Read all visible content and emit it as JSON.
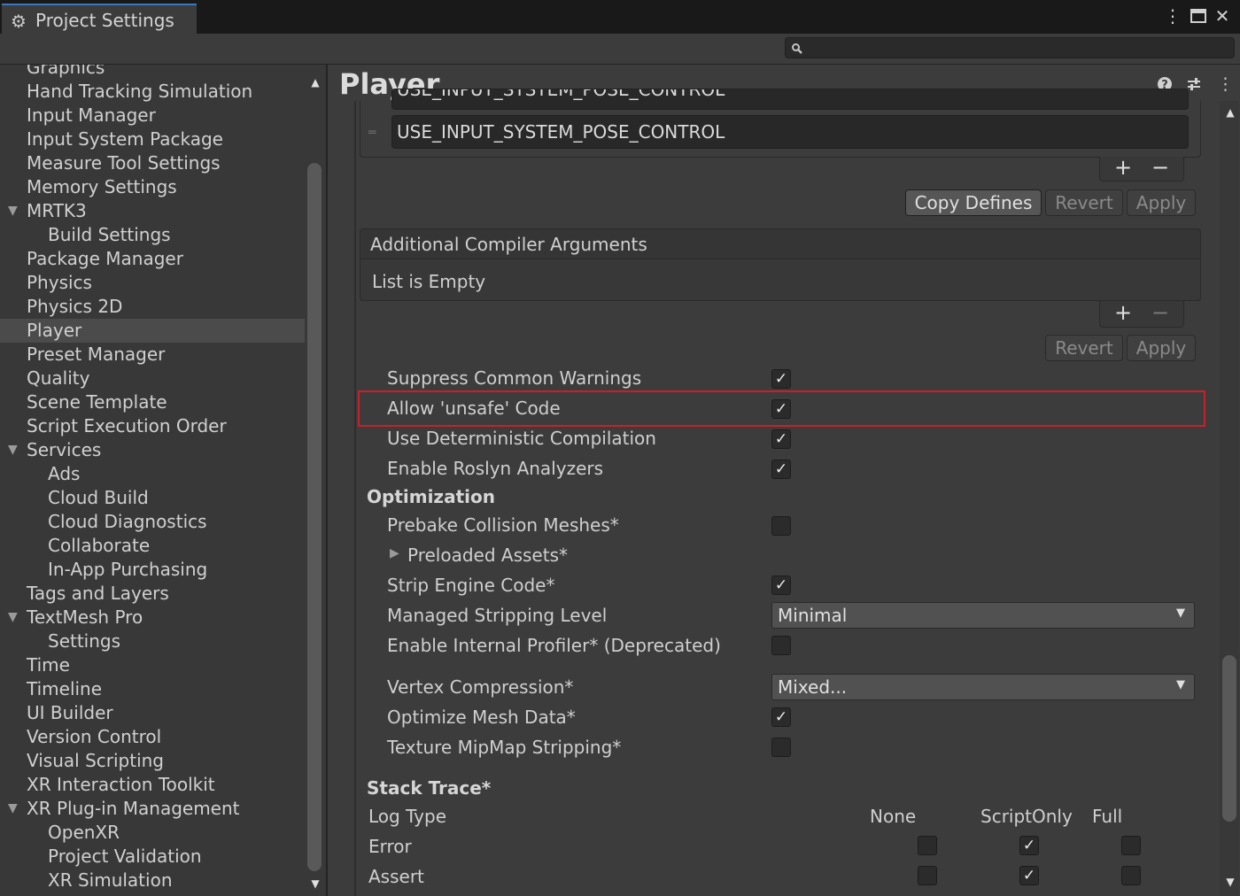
{
  "window": {
    "tab_title": "Project Settings",
    "tab_icon": "gear-icon"
  },
  "search": {
    "value": "",
    "placeholder": ""
  },
  "sidebar": {
    "items": [
      {
        "label": "Graphics",
        "indent": 0,
        "expandable": false,
        "selected": false
      },
      {
        "label": "Hand Tracking Simulation",
        "indent": 0,
        "expandable": false,
        "selected": false
      },
      {
        "label": "Input Manager",
        "indent": 0,
        "expandable": false,
        "selected": false
      },
      {
        "label": "Input System Package",
        "indent": 0,
        "expandable": false,
        "selected": false
      },
      {
        "label": "Measure Tool Settings",
        "indent": 0,
        "expandable": false,
        "selected": false
      },
      {
        "label": "Memory Settings",
        "indent": 0,
        "expandable": false,
        "selected": false
      },
      {
        "label": "MRTK3",
        "indent": 0,
        "expandable": true,
        "selected": false
      },
      {
        "label": "Build Settings",
        "indent": 1,
        "expandable": false,
        "selected": false
      },
      {
        "label": "Package Manager",
        "indent": 0,
        "expandable": false,
        "selected": false
      },
      {
        "label": "Physics",
        "indent": 0,
        "expandable": false,
        "selected": false
      },
      {
        "label": "Physics 2D",
        "indent": 0,
        "expandable": false,
        "selected": false
      },
      {
        "label": "Player",
        "indent": 0,
        "expandable": false,
        "selected": true
      },
      {
        "label": "Preset Manager",
        "indent": 0,
        "expandable": false,
        "selected": false
      },
      {
        "label": "Quality",
        "indent": 0,
        "expandable": false,
        "selected": false
      },
      {
        "label": "Scene Template",
        "indent": 0,
        "expandable": false,
        "selected": false
      },
      {
        "label": "Script Execution Order",
        "indent": 0,
        "expandable": false,
        "selected": false
      },
      {
        "label": "Services",
        "indent": 0,
        "expandable": true,
        "selected": false
      },
      {
        "label": "Ads",
        "indent": 1,
        "expandable": false,
        "selected": false
      },
      {
        "label": "Cloud Build",
        "indent": 1,
        "expandable": false,
        "selected": false
      },
      {
        "label": "Cloud Diagnostics",
        "indent": 1,
        "expandable": false,
        "selected": false
      },
      {
        "label": "Collaborate",
        "indent": 1,
        "expandable": false,
        "selected": false
      },
      {
        "label": "In-App Purchasing",
        "indent": 1,
        "expandable": false,
        "selected": false
      },
      {
        "label": "Tags and Layers",
        "indent": 0,
        "expandable": false,
        "selected": false
      },
      {
        "label": "TextMesh Pro",
        "indent": 0,
        "expandable": true,
        "selected": false
      },
      {
        "label": "Settings",
        "indent": 1,
        "expandable": false,
        "selected": false
      },
      {
        "label": "Time",
        "indent": 0,
        "expandable": false,
        "selected": false
      },
      {
        "label": "Timeline",
        "indent": 0,
        "expandable": false,
        "selected": false
      },
      {
        "label": "UI Builder",
        "indent": 0,
        "expandable": false,
        "selected": false
      },
      {
        "label": "Version Control",
        "indent": 0,
        "expandable": false,
        "selected": false
      },
      {
        "label": "Visual Scripting",
        "indent": 0,
        "expandable": false,
        "selected": false
      },
      {
        "label": "XR Interaction Toolkit",
        "indent": 0,
        "expandable": false,
        "selected": false
      },
      {
        "label": "XR Plug-in Management",
        "indent": 0,
        "expandable": true,
        "selected": false
      },
      {
        "label": "OpenXR",
        "indent": 1,
        "expandable": false,
        "selected": false
      },
      {
        "label": "Project Validation",
        "indent": 1,
        "expandable": false,
        "selected": false
      },
      {
        "label": "XR Simulation",
        "indent": 1,
        "expandable": false,
        "selected": false
      }
    ]
  },
  "main": {
    "title": "Player",
    "header_icons": [
      "help-icon",
      "presets-icon",
      "more-icon"
    ],
    "defines": {
      "partial_row": "USE_INPUT_SYSTEM_POSE_CONTROL",
      "row": "USE_INPUT_SYSTEM_POSE_CONTROL",
      "copy_defines_label": "Copy Defines",
      "revert_label": "Revert",
      "apply_label": "Apply"
    },
    "compiler_args": {
      "header": "Additional Compiler Arguments",
      "empty_text": "List is Empty",
      "revert_label": "Revert",
      "apply_label": "Apply"
    },
    "toggles": [
      {
        "label": "Suppress Common Warnings",
        "checked": true
      },
      {
        "label": "Allow 'unsafe' Code",
        "checked": true
      },
      {
        "label": "Use Deterministic Compilation",
        "checked": true
      },
      {
        "label": "Enable Roslyn Analyzers",
        "checked": true
      }
    ],
    "optimization": {
      "header": "Optimization",
      "prebake": {
        "label": "Prebake Collision Meshes*",
        "checked": false
      },
      "preloaded": {
        "label": "Preloaded Assets*"
      },
      "strip_engine": {
        "label": "Strip Engine Code*",
        "checked": true
      },
      "stripping_level": {
        "label": "Managed Stripping Level",
        "value": "Minimal"
      },
      "internal_profiler": {
        "label": "Enable Internal Profiler* (Deprecated)",
        "checked": false
      },
      "vertex_compression": {
        "label": "Vertex Compression*",
        "value": "Mixed..."
      },
      "optimize_mesh": {
        "label": "Optimize Mesh Data*",
        "checked": true
      },
      "mipmap_stripping": {
        "label": "Texture MipMap Stripping*",
        "checked": false
      }
    },
    "stack_trace": {
      "header": "Stack Trace*",
      "log_type_label": "Log Type",
      "columns": [
        "None",
        "ScriptOnly",
        "Full"
      ],
      "rows": [
        {
          "label": "Error",
          "selected": "ScriptOnly"
        },
        {
          "label": "Assert",
          "selected": "ScriptOnly"
        }
      ]
    }
  },
  "colors": {
    "highlight_border": "#c8202a",
    "selected_row": "#4b4b4b",
    "tab_accent": "#3a79bb"
  }
}
